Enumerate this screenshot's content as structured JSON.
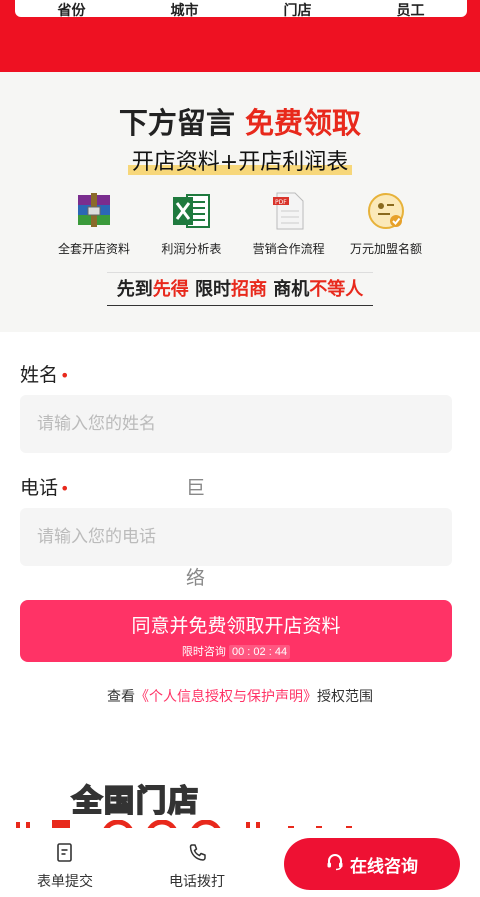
{
  "stats": {
    "labels": [
      "省份",
      "城市",
      "门店",
      "员工"
    ]
  },
  "promo": {
    "title_prefix": "下方留言",
    "title_highlight": "免费领取",
    "subtitle": "开店资料+开店利润表",
    "features": [
      {
        "icon": "winrar-archive-icon",
        "label": "全套开店资料"
      },
      {
        "icon": "excel-icon",
        "label": "利润分析表"
      },
      {
        "icon": "pdf-icon",
        "label": "营销合作流程"
      },
      {
        "icon": "badge-check-icon",
        "label": "万元加盟名额"
      }
    ],
    "slogan": {
      "p1": "先到",
      "p2": "先得",
      "p3": " 限时",
      "p4": "招商",
      "p5": " 商机",
      "p6": "不等人"
    }
  },
  "form": {
    "name_label": "姓名",
    "name_required": "•",
    "name_placeholder": "请输入您的姓名",
    "phone_label": "电话",
    "phone_required": "•",
    "phone_placeholder": "请输入您的电话",
    "watermark": "巨宣网络"
  },
  "submit": {
    "label": "同意并免费领取开店资料",
    "timer_prefix": "限时咨询",
    "hh": "00",
    "mm": "02",
    "ss": "44",
    "sep": ":"
  },
  "policy": {
    "prefix": "查看",
    "link": "《个人信息授权与保护声明》",
    "suffix": "授权范围"
  },
  "stores": {
    "title": "全国门店"
  },
  "bottom": {
    "form_tab": "表单提交",
    "phone_tab": "电话拨打",
    "consult": "在线咨询"
  },
  "colors": {
    "brand_red": "#ee1122",
    "accent_pink": "#ff3366",
    "highlight": "#e8291c"
  }
}
